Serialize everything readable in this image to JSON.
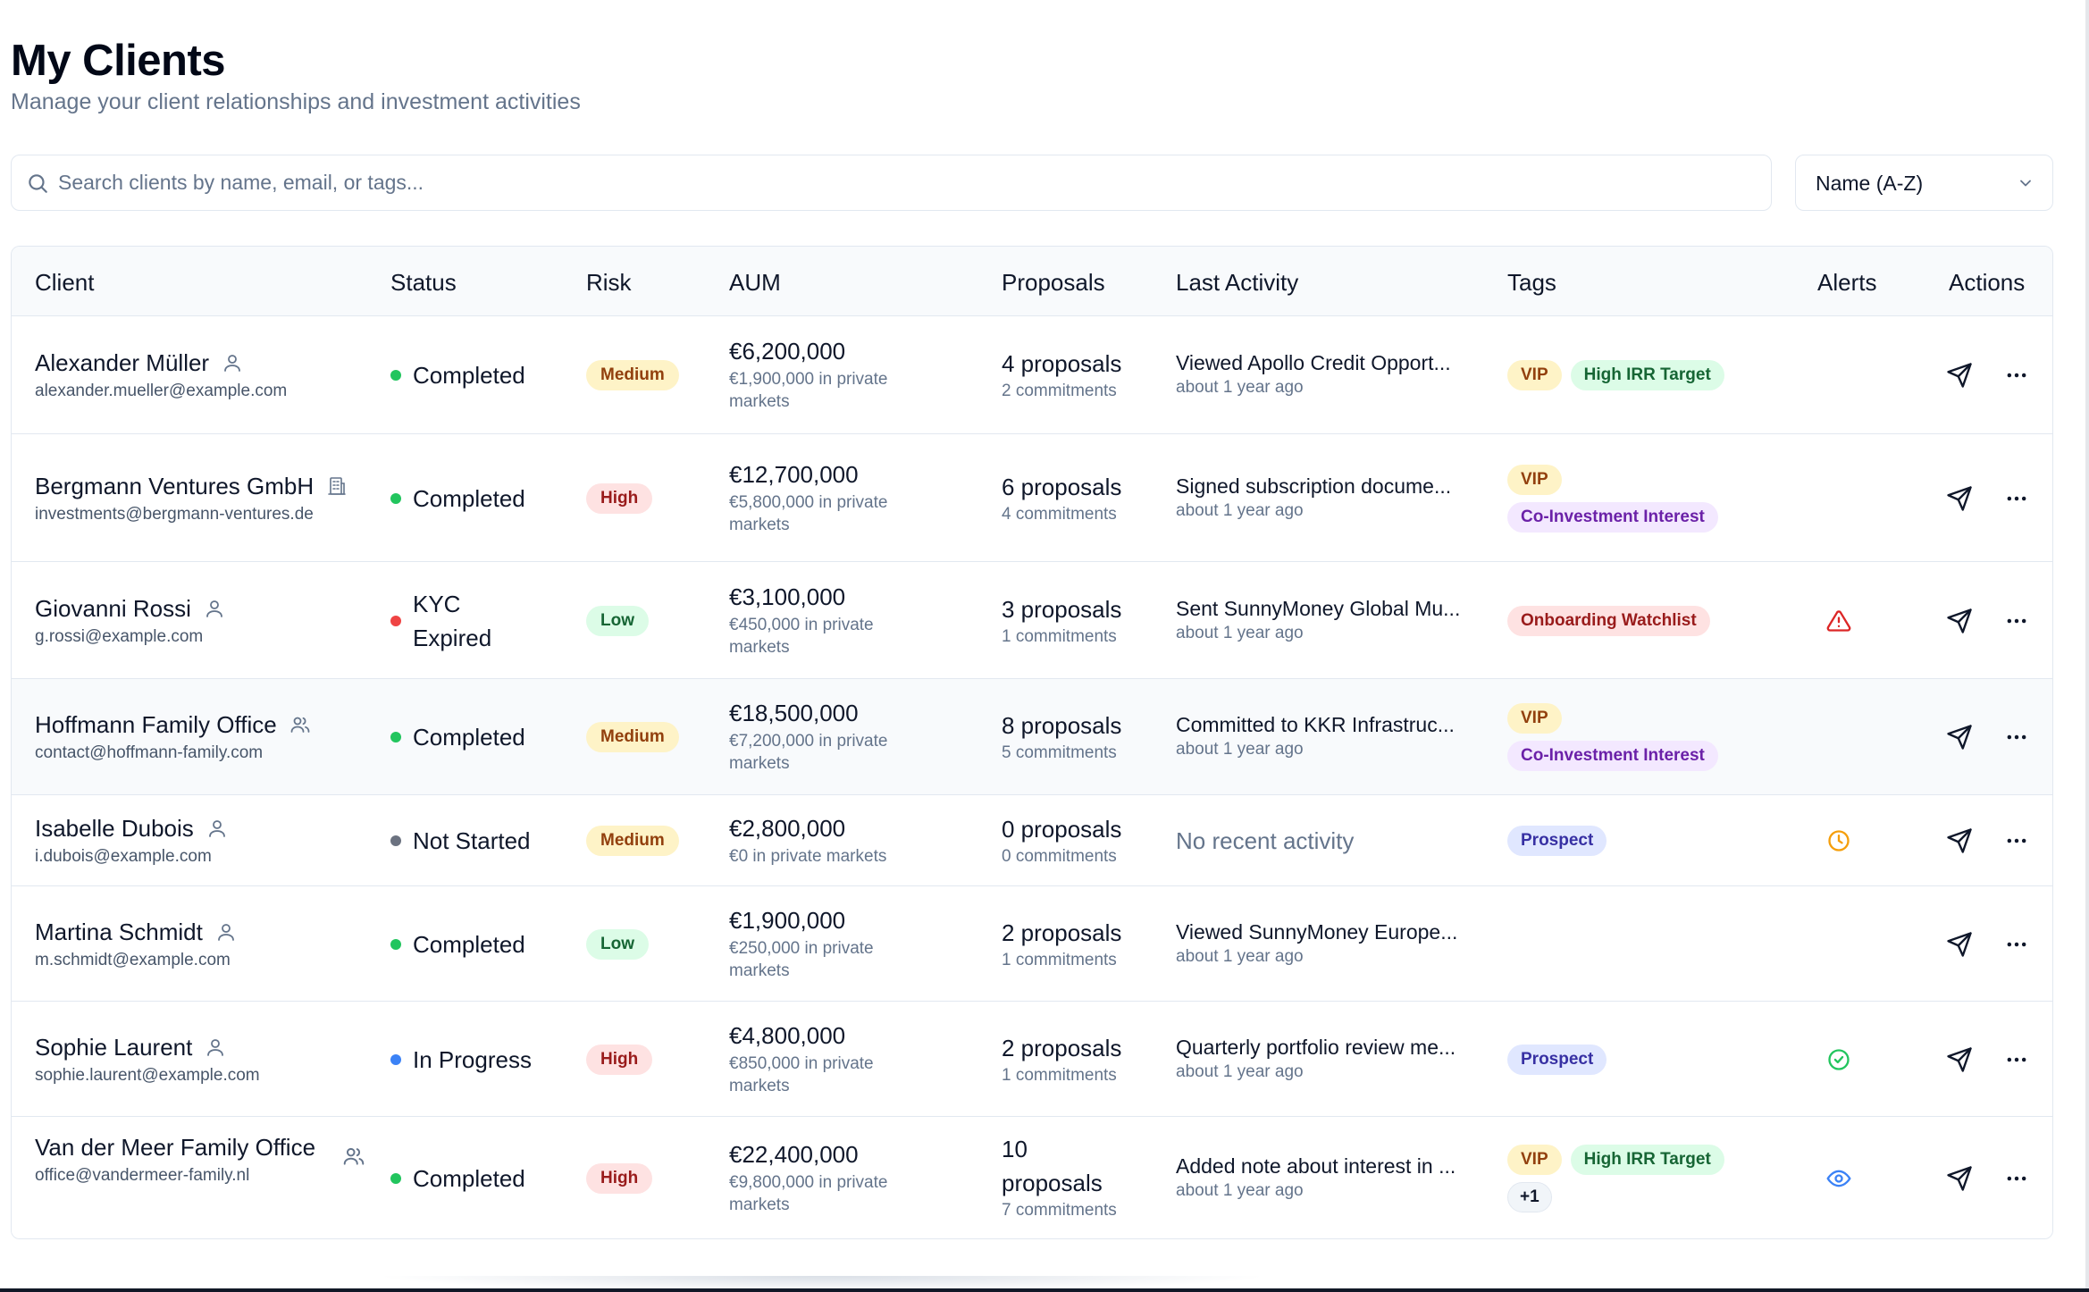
{
  "page": {
    "title": "My Clients",
    "subtitle": "Manage your client relationships and investment activities"
  },
  "search": {
    "placeholder": "Search clients by name, email, or tags...",
    "icon": "search-icon"
  },
  "sort": {
    "selected": "Name (A-Z)"
  },
  "table": {
    "columns": [
      "Client",
      "Status",
      "Risk",
      "AUM",
      "Proposals",
      "Last Activity",
      "Tags",
      "Alerts",
      "Actions"
    ],
    "rows": [
      {
        "name": "Alexander Müller",
        "email": "alexander.mueller@example.com",
        "type": "individual",
        "status": "Completed",
        "status_color": "#22c55e",
        "risk": "Medium",
        "aum": "€6,200,000",
        "aum_private": "€1,900,000 in private markets",
        "proposals": "4 proposals",
        "commitments": "2 commitments",
        "activity": "Viewed Apollo Credit Opport...",
        "activity_time": "about 1 year ago",
        "tags": [
          [
            "VIP",
            "High IRR Target"
          ]
        ],
        "alert": ""
      },
      {
        "name": "Bergmann Ventures GmbH",
        "email": "investments@bergmann-ventures.de",
        "type": "company",
        "status": "Completed",
        "status_color": "#22c55e",
        "risk": "High",
        "aum": "€12,700,000",
        "aum_private": "€5,800,000 in private markets",
        "proposals": "6 proposals",
        "commitments": "4 commitments",
        "activity": "Signed subscription docume...",
        "activity_time": "about 1 year ago",
        "tags": [
          [
            "VIP"
          ],
          [
            "Co-Investment Interest"
          ]
        ],
        "alert": ""
      },
      {
        "name": "Giovanni Rossi",
        "email": "g.rossi@example.com",
        "type": "individual",
        "status": "KYC Expired",
        "status_color": "#ef4444",
        "risk": "Low",
        "aum": "€3,100,000",
        "aum_private": "€450,000 in private markets",
        "proposals": "3 proposals",
        "commitments": "1 commitments",
        "activity": "Sent SunnyMoney Global Mu...",
        "activity_time": "about 1 year ago",
        "tags": [
          [
            "Onboarding Watchlist"
          ]
        ],
        "alert": "warning-triangle-icon"
      },
      {
        "name": "Hoffmann Family Office",
        "email": "contact@hoffmann-family.com",
        "type": "family",
        "status": "Completed",
        "status_color": "#22c55e",
        "risk": "Medium",
        "aum": "€18,500,000",
        "aum_private": "€7,200,000 in private markets",
        "proposals": "8 proposals",
        "commitments": "5 commitments",
        "activity": "Committed to KKR Infrastruc...",
        "activity_time": "about 1 year ago",
        "tags": [
          [
            "VIP"
          ],
          [
            "Co-Investment Interest"
          ]
        ],
        "alert": ""
      },
      {
        "name": "Isabelle Dubois",
        "email": "i.dubois@example.com",
        "type": "individual",
        "status": "Not Started",
        "status_color": "#6b7280",
        "risk": "Medium",
        "aum": "€2,800,000",
        "aum_private": "€0 in private markets",
        "proposals": "0 proposals",
        "commitments": "0 commitments",
        "activity": "No recent activity",
        "activity_time": "",
        "tags": [
          [
            "Prospect"
          ]
        ],
        "alert": "clock-icon"
      },
      {
        "name": "Martina Schmidt",
        "email": "m.schmidt@example.com",
        "type": "individual",
        "status": "Completed",
        "status_color": "#22c55e",
        "risk": "Low",
        "aum": "€1,900,000",
        "aum_private": "€250,000 in private markets",
        "proposals": "2 proposals",
        "commitments": "1 commitments",
        "activity": "Viewed SunnyMoney Europe...",
        "activity_time": "about 1 year ago",
        "tags": [],
        "alert": ""
      },
      {
        "name": "Sophie Laurent",
        "email": "sophie.laurent@example.com",
        "type": "individual",
        "status": "In Progress",
        "status_color": "#3b82f6",
        "risk": "High",
        "aum": "€4,800,000",
        "aum_private": "€850,000 in private markets",
        "proposals": "2 proposals",
        "commitments": "1 commitments",
        "activity": "Quarterly portfolio review me...",
        "activity_time": "about 1 year ago",
        "tags": [
          [
            "Prospect"
          ]
        ],
        "alert": "check-circle-icon"
      },
      {
        "name": "Van der Meer Family Office",
        "email": "office@vandermeer-family.nl",
        "type": "family",
        "status": "Completed",
        "status_color": "#22c55e",
        "risk": "High",
        "aum": "€22,400,000",
        "aum_private": "€9,800,000 in private markets",
        "proposals": "10 proposals",
        "commitments": "7 commitments",
        "activity": "Added note about interest in ...",
        "activity_time": "about 1 year ago",
        "tags": [
          [
            "VIP",
            "High IRR Target"
          ],
          [
            "+1"
          ]
        ],
        "alert": "eye-icon"
      }
    ]
  },
  "colors": {
    "warning": "#dc2626",
    "clock": "#f59e0b",
    "check": "#22c55e",
    "eye": "#3b82f6"
  }
}
